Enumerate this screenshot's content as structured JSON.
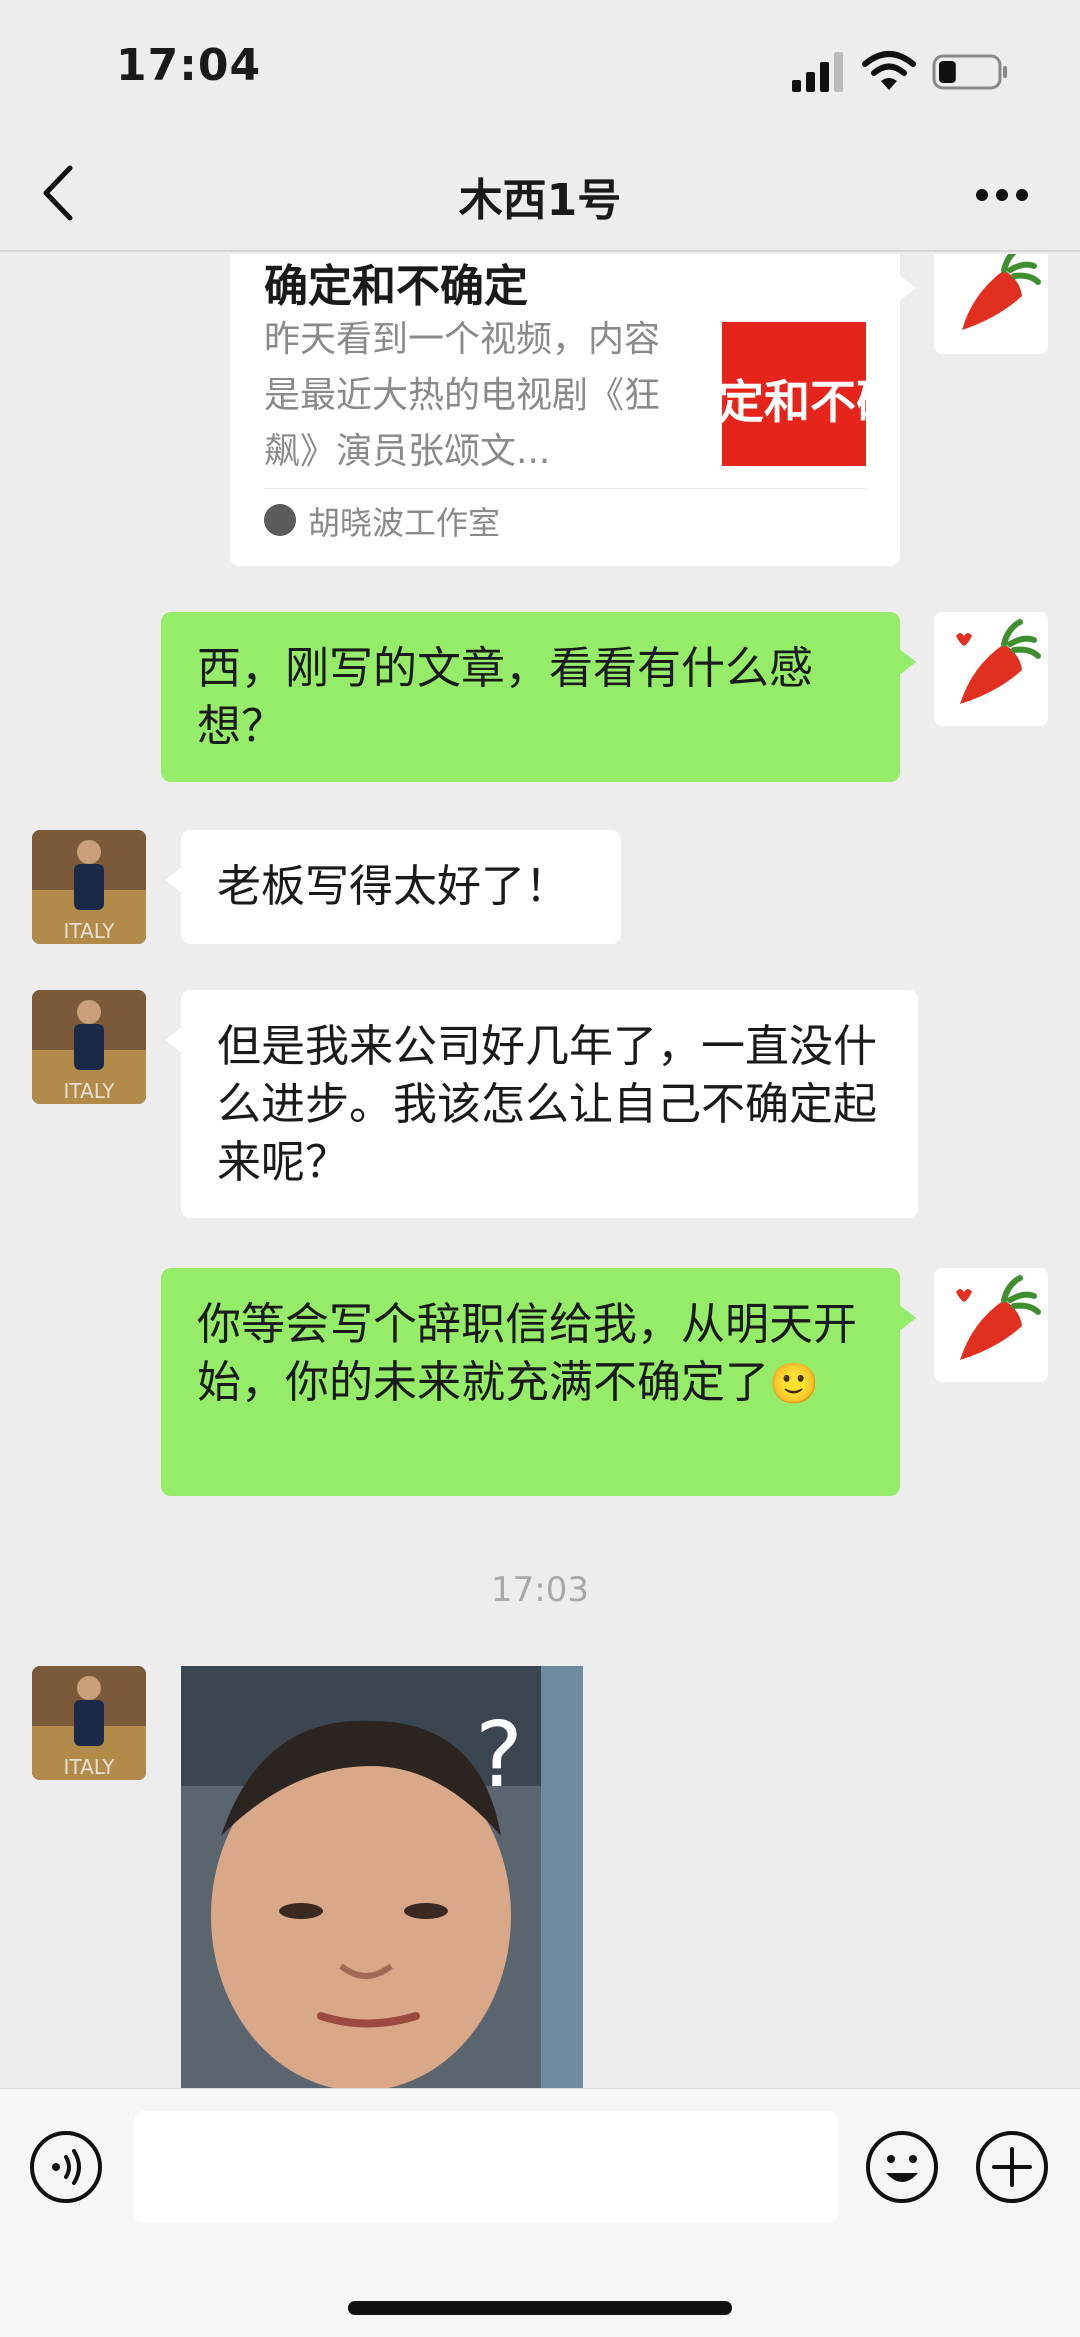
{
  "status_bar": {
    "time": "17:04",
    "battery_level": 0.3
  },
  "navbar": {
    "title": "木西1号",
    "back_icon": "chevron-left-icon",
    "more_icon": "more-dots-icon"
  },
  "messages": {
    "article": {
      "title": "确定和不确定",
      "description": "昨天看到一个视频，内容是最近大热的电视剧《狂飙》演员张颂文...",
      "thumbnail_text": "定和不确",
      "source": "胡晓波工作室"
    },
    "m1": {
      "text": "西，刚写的文章，看看有什么感想？"
    },
    "m2": {
      "text": "老板写得太好了！"
    },
    "m3": {
      "text": "但是我来公司好几年了，一直没什么进步。我该怎么让自己不确定起来呢？"
    },
    "m4": {
      "text": "你等会写个辞职信给我，从明天开始，你的未来就充满不确定了",
      "emoji": "🙂"
    },
    "timestamp": "17:03",
    "photo": {
      "caption": "?"
    }
  },
  "input_bar": {
    "voice_icon": "voice-icon",
    "emoji_icon": "emoji-icon",
    "plus_icon": "plus-icon",
    "value": ""
  },
  "colors": {
    "background": "#ededed",
    "my_bubble": "#95ec69",
    "their_bubble": "#ffffff",
    "accent_red": "#e5241b"
  }
}
